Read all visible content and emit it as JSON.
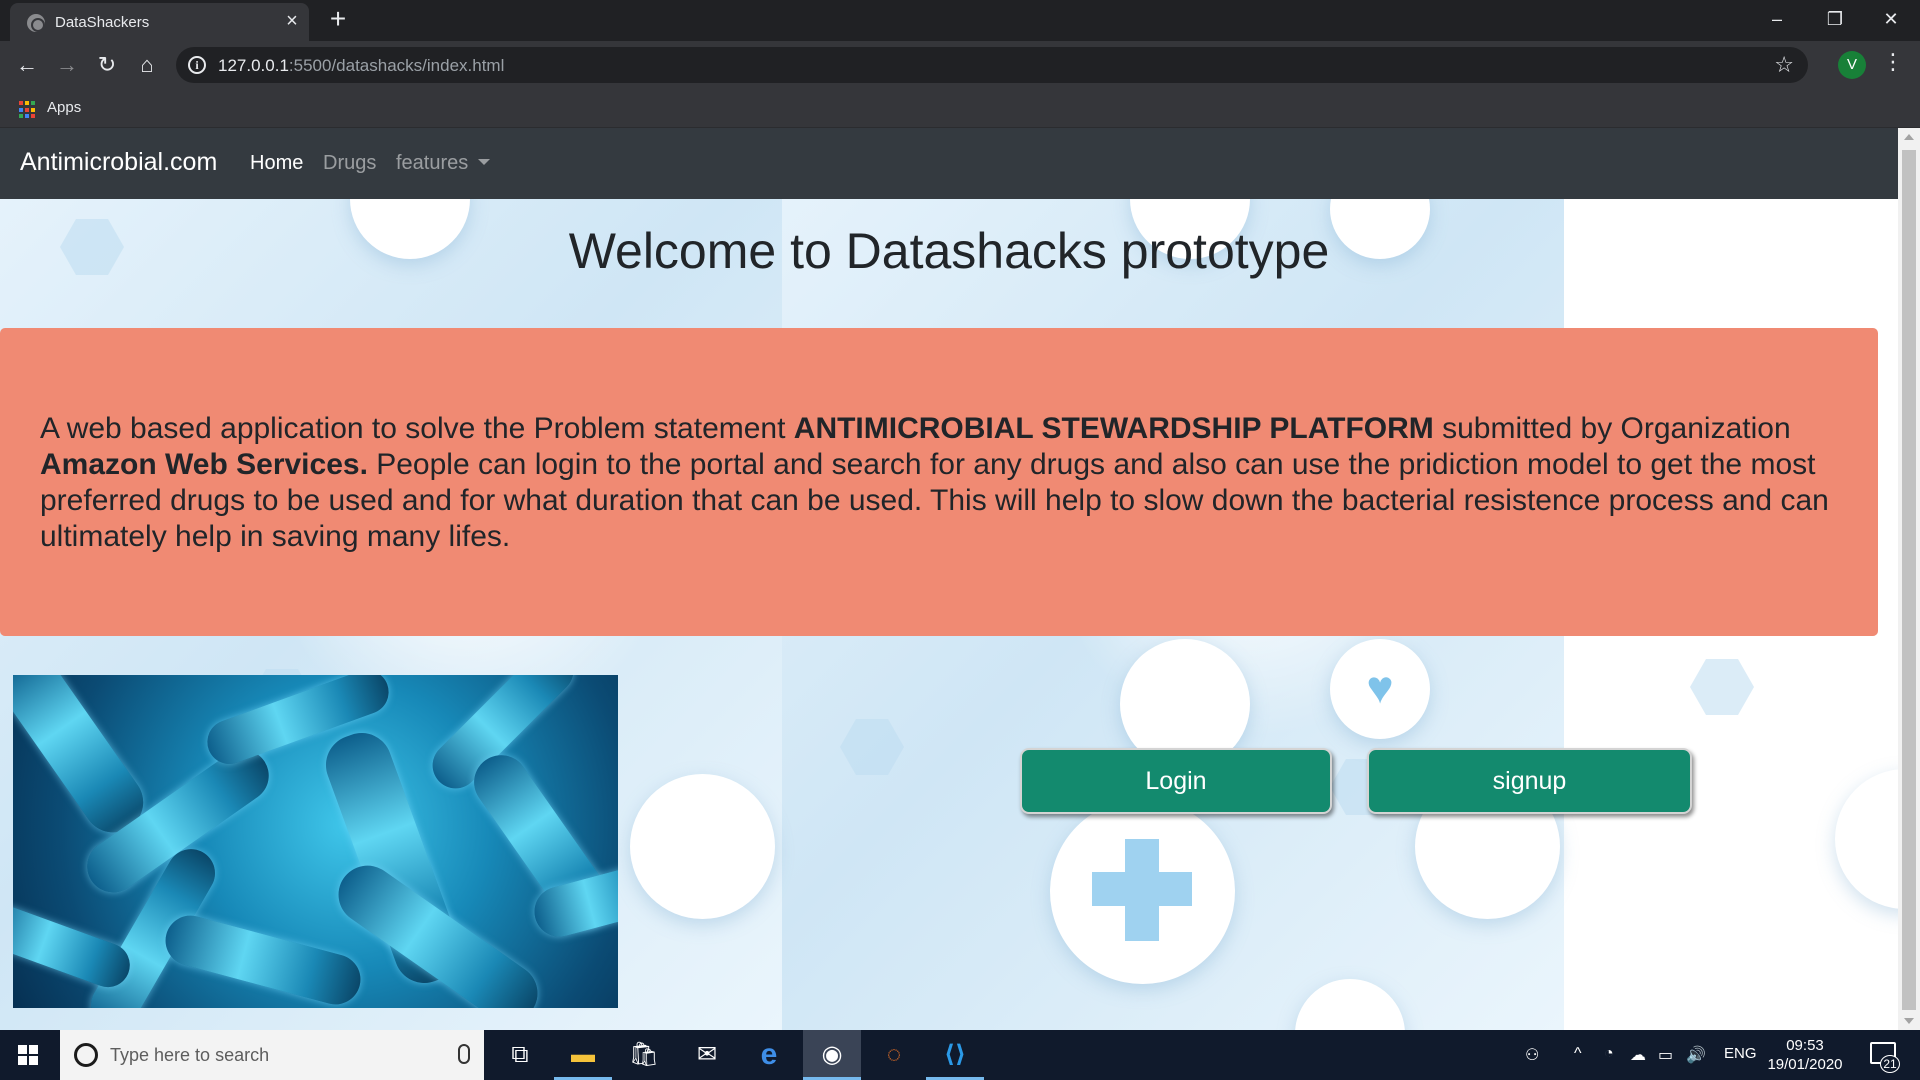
{
  "browser": {
    "tab_title": "DataShackers",
    "url_host": "127.0.0.1",
    "url_path": ":5500/datashacks/index.html",
    "profile_initial": "V",
    "bookmarks_apps_label": "Apps"
  },
  "navbar": {
    "brand": "Antimicrobial.com",
    "links": [
      "Home",
      "Drugs",
      "features"
    ]
  },
  "main": {
    "heading": "Welcome to Datashacks prototype",
    "description": {
      "part1": "A web based application to solve the Problem statement ",
      "bold1": "ANTIMICROBIAL STEWARDSHIP PLATFORM",
      "part2": " submitted by Organization ",
      "bold2": "Amazon Web Services.",
      "part3": " People can login to the portal and search for any drugs and also can use the pridiction model to get the most preferred drugs to be used and for what duration that can be used. This will help to slow down the bacterial resistence process and can ultimately help in saving many lifes."
    },
    "login_label": "Login",
    "signup_label": "signup"
  },
  "taskbar": {
    "search_placeholder": "Type here to search",
    "language": "ENG",
    "time": "09:53",
    "date": "19/01/2020",
    "notifications": "21"
  },
  "colors": {
    "navbar_bg": "#343a40",
    "jumbotron_bg": "#f08a73",
    "button_bg": "#138a6e"
  }
}
